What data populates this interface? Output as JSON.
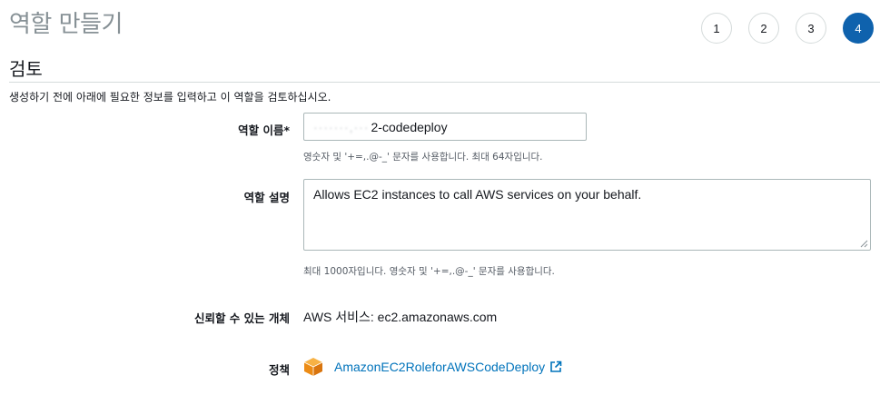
{
  "page_title": "역할 만들기",
  "steps": [
    {
      "label": "1"
    },
    {
      "label": "2"
    },
    {
      "label": "3"
    },
    {
      "label": "4"
    }
  ],
  "active_step": "4",
  "section": {
    "title": "검토",
    "description": "생성하기 전에 아래에 필요한 정보를 입력하고 이 역할을 검토하십시오."
  },
  "role_name": {
    "label": "역할 이름*",
    "value_visible": "2-codedeploy",
    "hint": "영숫자 및 '+=,.@-_' 문자를 사용합니다. 최대 64자입니다."
  },
  "role_description": {
    "label": "역할 설명",
    "value": "Allows EC2 instances to call AWS services on your behalf.",
    "hint": "최대 1000자입니다. 영숫자 및 '+=,.@-_' 문자를 사용합니다."
  },
  "trusted_entity": {
    "label": "신뢰할 수 있는 개체",
    "value": "AWS 서비스: ec2.amazonaws.com"
  },
  "policy": {
    "label": "정책",
    "link_text": "AmazonEC2RoleforAWSCodeDeploy",
    "icon": "aws-policy-cube-icon",
    "link_icon": "external-link-icon"
  },
  "colors": {
    "active_step": "#0f62ad",
    "link": "#0073bb",
    "policy_icon": "#f90"
  }
}
